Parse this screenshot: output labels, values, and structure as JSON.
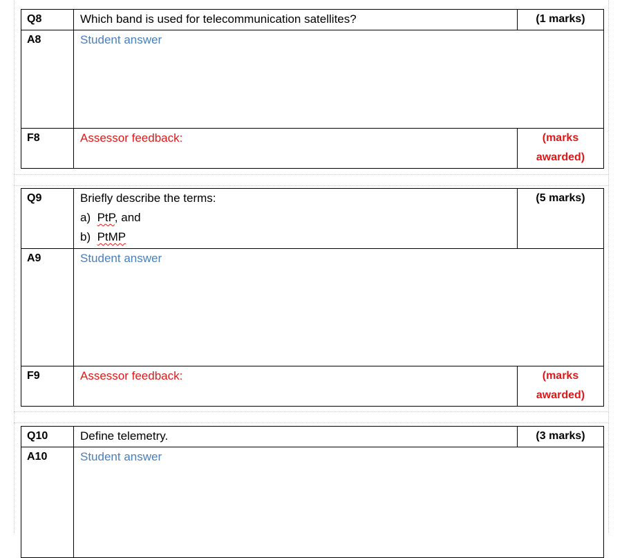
{
  "questions": [
    {
      "q_label": "Q8",
      "question": "Which band is used for telecommunication satellites?",
      "marks": "(1 marks)",
      "a_label": "A8",
      "answer": "Student answer",
      "f_label": "F8",
      "feedback": "Assessor feedback:",
      "awarded_1": "(marks",
      "awarded_2": "awarded)"
    },
    {
      "q_label": "Q9",
      "question": "Briefly describe the terms:",
      "items": [
        {
          "prefix": "a)",
          "term": "PtP",
          "suffix": ", and"
        },
        {
          "prefix": "b)",
          "term": "PtMP",
          "suffix": ""
        }
      ],
      "marks": "(5 marks)",
      "a_label": "A9",
      "answer": "Student answer",
      "f_label": "F9",
      "feedback": "Assessor feedback:",
      "awarded_1": "(marks",
      "awarded_2": "awarded)"
    },
    {
      "q_label": "Q10",
      "question": "Define telemetry.",
      "marks": "(3 marks)",
      "a_label": "A10",
      "answer": "Student answer"
    }
  ]
}
